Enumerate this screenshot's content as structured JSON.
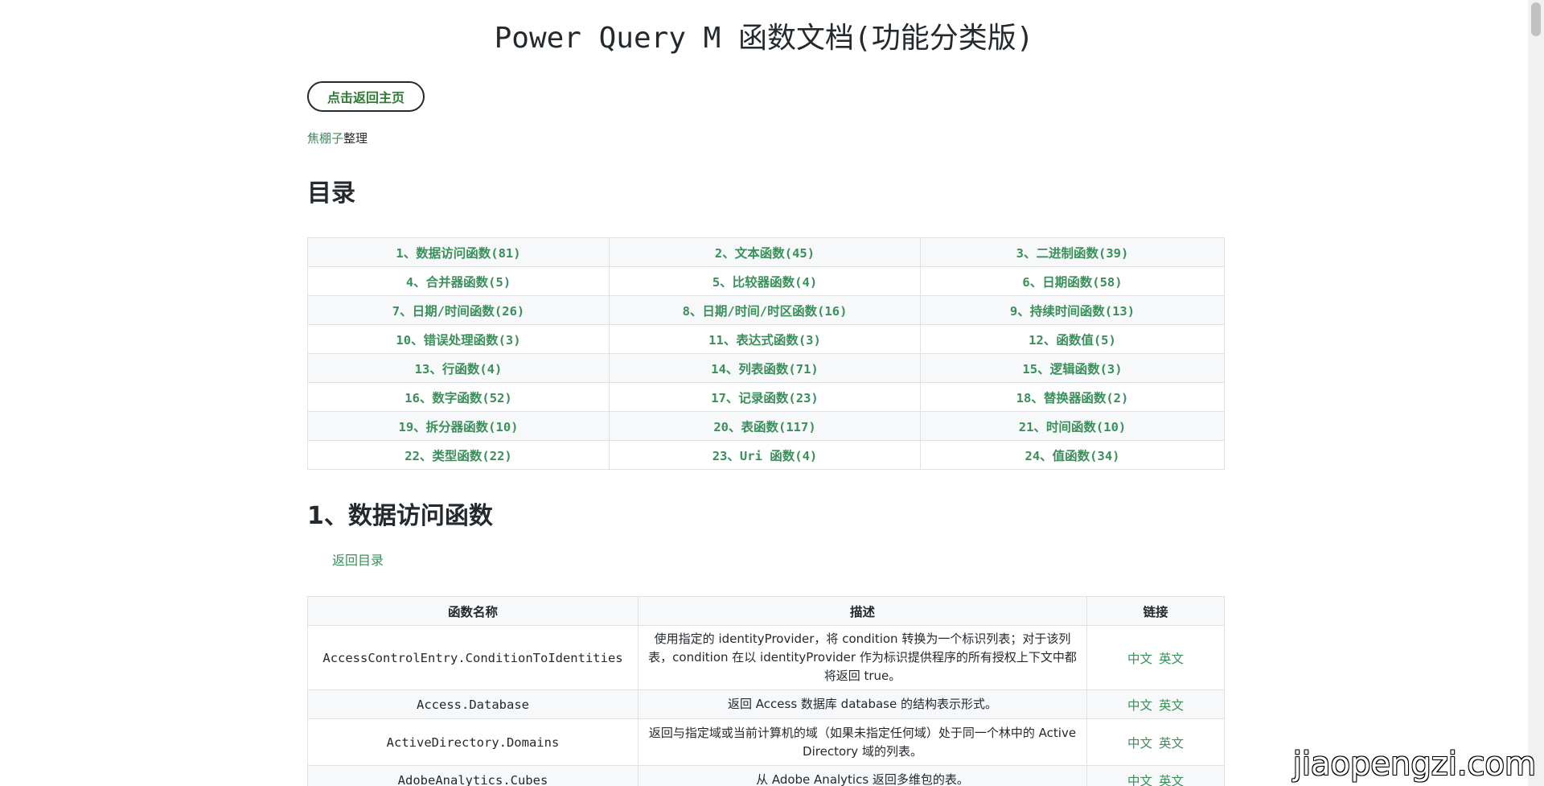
{
  "page": {
    "title": "Power Query M 函数文档(功能分类版)",
    "home_button": "点击返回主页",
    "credit_name": "焦棚子",
    "credit_suffix": "整理",
    "toc_heading": "目录"
  },
  "toc": [
    [
      "1、数据访问函数(81)",
      "2、文本函数(45)",
      "3、二进制函数(39)"
    ],
    [
      "4、合并器函数(5)",
      "5、比较器函数(4)",
      "6、日期函数(58)"
    ],
    [
      "7、日期/时间函数(26)",
      "8、日期/时间/时区函数(16)",
      "9、持续时间函数(13)"
    ],
    [
      "10、错误处理函数(3)",
      "11、表达式函数(3)",
      "12、函数值(5)"
    ],
    [
      "13、行函数(4)",
      "14、列表函数(71)",
      "15、逻辑函数(3)"
    ],
    [
      "16、数字函数(52)",
      "17、记录函数(23)",
      "18、替换器函数(2)"
    ],
    [
      "19、拆分器函数(10)",
      "20、表函数(117)",
      "21、时间函数(10)"
    ],
    [
      "22、类型函数(22)",
      "23、Uri 函数(4)",
      "24、值函数(34)"
    ]
  ],
  "section": {
    "heading": "1、数据访问函数",
    "back_link": "返回目录",
    "columns": [
      "函数名称",
      "描述",
      "链接"
    ],
    "rows": [
      {
        "name": "AccessControlEntry.ConditionToIdentities",
        "desc": "使用指定的 identityProvider，将 condition 转换为一个标识列表；对于该列表，condition 在以 identityProvider 作为标识提供程序的所有授权上下文中都将返回 true。",
        "zh": "中文",
        "en": "英文"
      },
      {
        "name": "Access.Database",
        "desc": "返回 Access 数据库 database 的结构表示形式。",
        "zh": "中文",
        "en": "英文"
      },
      {
        "name": "ActiveDirectory.Domains",
        "desc": "返回与指定域或当前计算机的域（如果未指定任何域）处于同一个林中的 Active Directory 域的列表。",
        "zh": "中文",
        "en": "英文"
      },
      {
        "name": "AdobeAnalytics.Cubes",
        "desc": "从 Adobe Analytics 返回多维包的表。",
        "zh": "中文",
        "en": "英文"
      }
    ]
  },
  "watermark": "jiaopengzi.com"
}
